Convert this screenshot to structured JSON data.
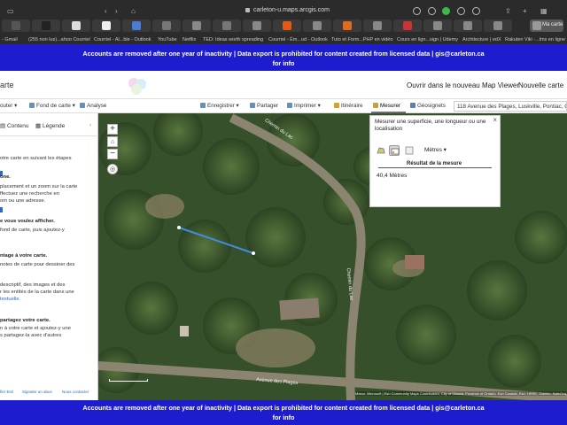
{
  "browser": {
    "url": "carleton-u.maps.arcgis.com",
    "active_tab": "Ma carte",
    "bookmarks": [
      "- Gmail",
      "(255 non lus)...ahoo Courriel",
      "Courriel - Al...ble - Outlook",
      "YouTube",
      "Netflix",
      "TED: Ideas worth spreading",
      "Courriel - Ém...od - Outlook",
      "Tuto et Form...PHP en vidéo",
      "Cours en lign...sign | Udemy",
      "Architecture | edX",
      "Rakuten Viki -...lms en ligne"
    ]
  },
  "banner": {
    "text": "Accounts are removed after one year of inactivity | Data export is prohibited for content created from licensed data | gis@carleton.ca for info"
  },
  "header": {
    "title": "arte",
    "open_map_viewer": "Ouvrir dans le nouveau Map Viewer",
    "new_map": "Nouvelle carte"
  },
  "toolbar": {
    "add": "outer",
    "basemap": "Fond de carte",
    "analysis": "Analyse",
    "save": "Enregistrer",
    "share": "Partager",
    "print": "Imprimer",
    "directions": "Itinéraire",
    "measure": "Mesurer",
    "geosignets": "Géosignets",
    "address": "118 Avenue des Plages, Luskville, Pontiac, Quebec, J0X 2G0"
  },
  "leftpanel": {
    "tab_contents": "Contenu",
    "tab_legend": "Légende",
    "lines": [
      "otre carte en suivant les étapes",
      "one.",
      "placement et un zoom sur la carte",
      "ffectuez une recherche en",
      "om ou une adresse.",
      "e vous voulez afficher.",
      "fond de carte, puis   ajoutez-y",
      "ntage à votre carte.",
      "notes de carte pour dessiner des",
      "descriptif, des images et des",
      "r les entités de la carte dans une",
      "textuelle.",
      "partagez votre carte.",
      "n à votre carte et ajoutez-y une",
      "s partagez-la avec d'autres"
    ],
    "footer": [
      "fier Esri",
      "Signaler un abus",
      "Nous contacter"
    ]
  },
  "map": {
    "zoom_in": "+",
    "zoom_out": "−",
    "road_1": "Chemin du Lac",
    "road_2": "Chemin du Lac",
    "road_3": "Avenue des Plages",
    "attribution": "Maxar, Microsoft | Esri Community Maps Contributors, City of Ottawa, Province of Ontario, Esri Canada, Esri, HERE, Garmin, SafeGraph"
  },
  "measure_panel": {
    "title": "Mesurer une superficie, une longueur ou une localisation",
    "close": "×",
    "unit": "Mètres",
    "result_label": "Résultat de la mesure",
    "result_value": "40,4 Mètres"
  },
  "colors": {
    "banner": "#1d1dcf",
    "measure_line": "#3e8ede",
    "link": "#2a6bbf"
  }
}
